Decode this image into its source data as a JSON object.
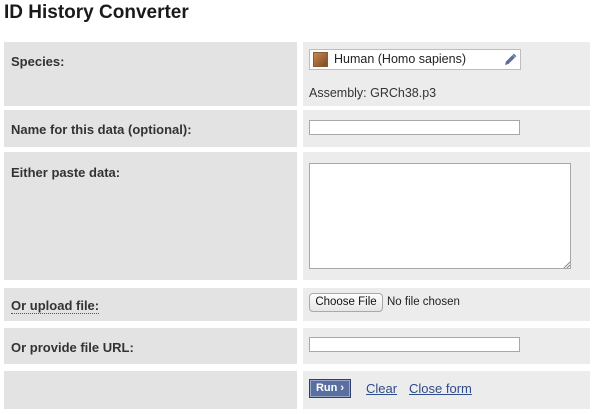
{
  "page": {
    "title": "ID History Converter"
  },
  "species": {
    "label": "Species:",
    "value": "Human (Homo sapiens)",
    "assembly": "Assembly: GRCh38.p3"
  },
  "name_field": {
    "label": "Name for this data (optional):",
    "value": ""
  },
  "paste": {
    "label": "Either paste data:",
    "value": ""
  },
  "upload": {
    "label": "Or upload file:",
    "button": "Choose File",
    "status": "No file chosen"
  },
  "url": {
    "label": "Or provide file URL:",
    "value": ""
  },
  "actions": {
    "run": "Run ›",
    "clear": "Clear",
    "close": "Close form"
  },
  "colors": {
    "link": "#2e4b8a",
    "run_button": "#5a6fa1",
    "label_bg": "#e3e3e3",
    "field_bg": "#ececec"
  }
}
